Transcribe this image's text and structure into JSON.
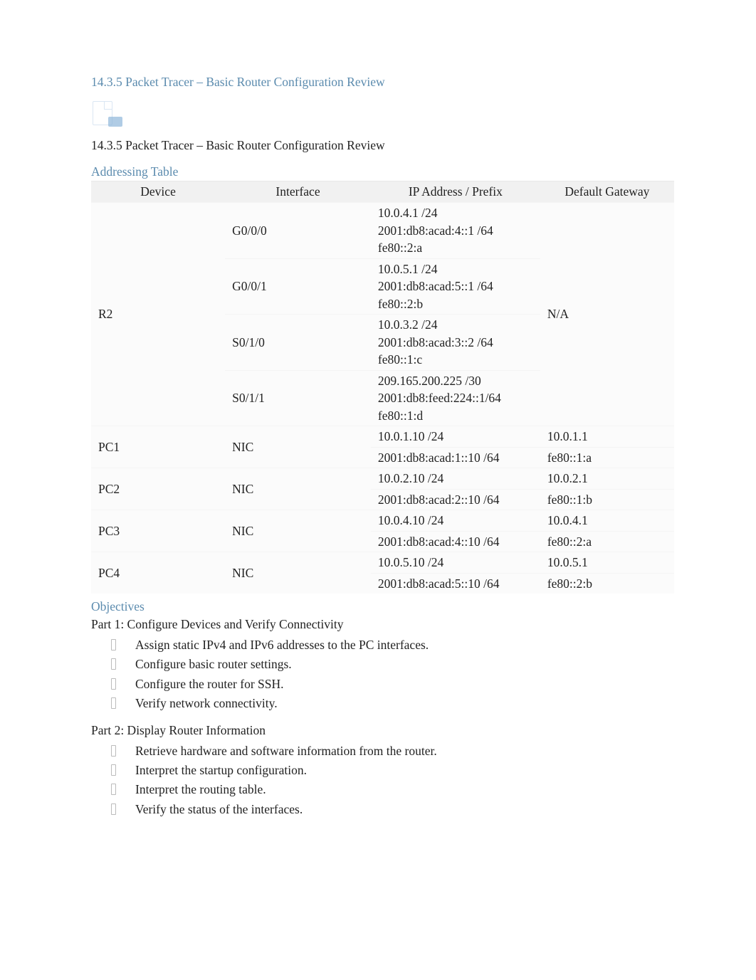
{
  "title_link": "14.3.5 Packet Tracer – Basic Router Configuration Review",
  "subtitle_black": "14.3.5 Packet Tracer – Basic Router Configuration Review",
  "addressing": {
    "heading": "Addressing Table",
    "headers": {
      "device": "Device",
      "iface": "Interface",
      "ip": "IP Address / Prefix",
      "gw": "Default Gateway"
    },
    "rows": {
      "r2": {
        "device": "R2",
        "gw": "N/A",
        "g000": {
          "iface": "G0/0/0",
          "ips": [
            "10.0.4.1 /24",
            "2001:db8:acad:4::1 /64",
            "fe80::2:a"
          ]
        },
        "g001": {
          "iface": "G0/0/1",
          "ips": [
            "10.0.5.1 /24",
            "2001:db8:acad:5::1 /64",
            "fe80::2:b"
          ]
        },
        "s010": {
          "iface": "S0/1/0",
          "ips": [
            "10.0.3.2 /24",
            "2001:db8:acad:3::2 /64",
            "fe80::1:c"
          ]
        },
        "s011": {
          "iface": "S0/1/1",
          "ips": [
            "209.165.200.225 /30",
            "2001:db8:feed:224::1/64",
            "fe80::1:d"
          ]
        }
      },
      "pc1": {
        "device": "PC1",
        "iface": "NIC",
        "ips": [
          "10.0.1.10 /24",
          "2001:db8:acad:1::10 /64"
        ],
        "gws": [
          "10.0.1.1",
          "fe80::1:a"
        ]
      },
      "pc2": {
        "device": "PC2",
        "iface": "NIC",
        "ips": [
          "10.0.2.10 /24",
          "2001:db8:acad:2::10 /64"
        ],
        "gws": [
          "10.0.2.1",
          "fe80::1:b"
        ]
      },
      "pc3": {
        "device": "PC3",
        "iface": "NIC",
        "ips": [
          "10.0.4.10 /24",
          "2001:db8:acad:4::10 /64"
        ],
        "gws": [
          "10.0.4.1",
          "fe80::2:a"
        ]
      },
      "pc4": {
        "device": "PC4",
        "iface": "NIC",
        "ips": [
          "10.0.5.10 /24",
          "2001:db8:acad:5::10 /64"
        ],
        "gws": [
          "10.0.5.1",
          "fe80::2:b"
        ]
      }
    }
  },
  "objectives": {
    "heading": "Objectives",
    "part1_label": "Part 1: Configure Devices and Verify Connectivity",
    "part1_items": [
      "Assign static IPv4 and IPv6 addresses to the PC interfaces.",
      "Configure basic router settings.",
      "Configure the router for SSH.",
      "Verify network connectivity."
    ],
    "part2_label": "Part 2: Display Router Information",
    "part2_items": [
      "Retrieve hardware and software information from the router.",
      "Interpret the startup configuration.",
      "Interpret the routing table.",
      "Verify the status of the interfaces."
    ]
  }
}
